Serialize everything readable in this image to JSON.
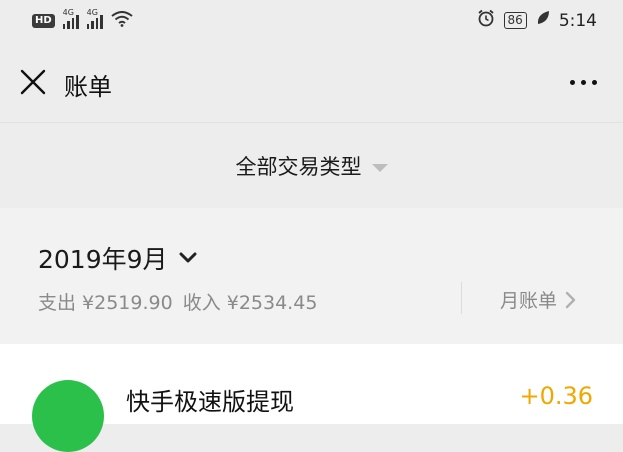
{
  "status_bar": {
    "left_badge": "HD",
    "network_1": "4G",
    "network_2": "4G",
    "battery": "86",
    "time": "5:14"
  },
  "header": {
    "title": "账单"
  },
  "filter": {
    "label": "全部交易类型"
  },
  "summary": {
    "month": "2019年9月",
    "expense": "支出 ¥2519.90",
    "income": "收入 ¥2534.45",
    "monthly_bill": "月账单"
  },
  "transactions": [
    {
      "name": "快手极速版提现",
      "amount": "+0.36"
    }
  ],
  "colors": {
    "background": "#ededed",
    "income_amount": "#f0a800",
    "icon_green": "#2bc04a"
  }
}
